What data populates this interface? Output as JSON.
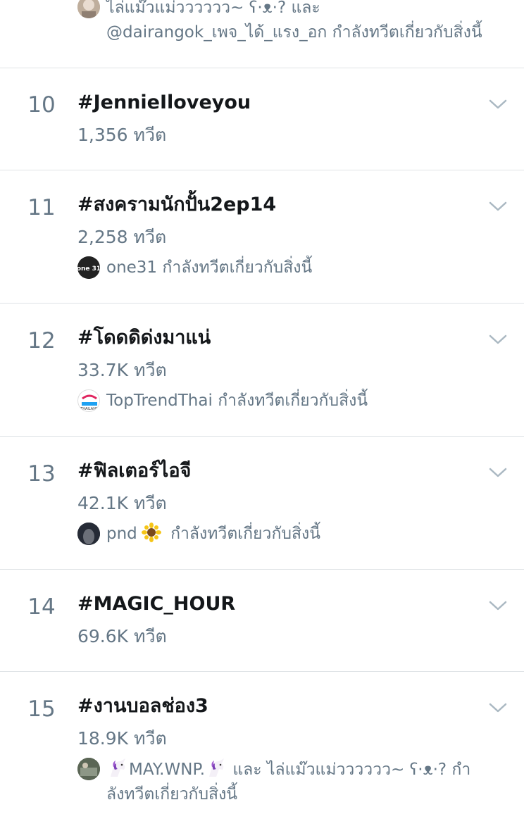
{
  "partial_item": {
    "line1": "ไล่แม๊วแม่วววววว~ ʕ·ᴥ·? และ",
    "line2": "@dairangok_เพจ_ได้_แรง_อก กำลังทวีตเกี่ยวกับสิ่งนี้"
  },
  "trends": [
    {
      "rank": "10",
      "hashtag": "#JennieIloveyou",
      "count": "1,356 ทวีต"
    },
    {
      "rank": "11",
      "hashtag": "#สงครามนักปั้น2ep14",
      "count": "2,258 ทวีต",
      "context_user": "one31",
      "context_suffix": "กำลังทวีตเกี่ยวกับสิ่งนี้",
      "avatar_label": "one 31"
    },
    {
      "rank": "12",
      "hashtag": "#โดดดิด่งมาแน่",
      "count": "33.7K ทวีต",
      "context_user": "TopTrendThai",
      "context_suffix": "กำลังทวีตเกี่ยวกับสิ่งนี้",
      "avatar_label": "THAILAND"
    },
    {
      "rank": "13",
      "hashtag": "#ฟิลเตอร์ไอจี",
      "count": "42.1K ทวีต",
      "context_user": "pnd",
      "context_suffix": "กำลังทวีตเกี่ยวกับสิ่งนี้"
    },
    {
      "rank": "14",
      "hashtag": "#MAGIC_HOUR",
      "count": "69.6K ทวีต"
    },
    {
      "rank": "15",
      "hashtag": "#งานบอลช่อง3",
      "count": "18.9K ทวีต",
      "context_user": "MAY.WNP.",
      "context_line1_tail": "และ ไล่แม๊วแม่วววววว~ ʕ·ᴥ·? กำ",
      "context_line2": "ลังทวีตเกี่ยวกับสิ่งนี้"
    }
  ],
  "icons": {
    "chevron": "chevron-down-icon",
    "sunflower": "sunflower-emoji",
    "unicorn": "unicorn-emoji"
  },
  "colors": {
    "primary_text": "#14171a",
    "secondary_text": "#657786",
    "divider": "#dfe3e6",
    "background": "#ffffff"
  }
}
